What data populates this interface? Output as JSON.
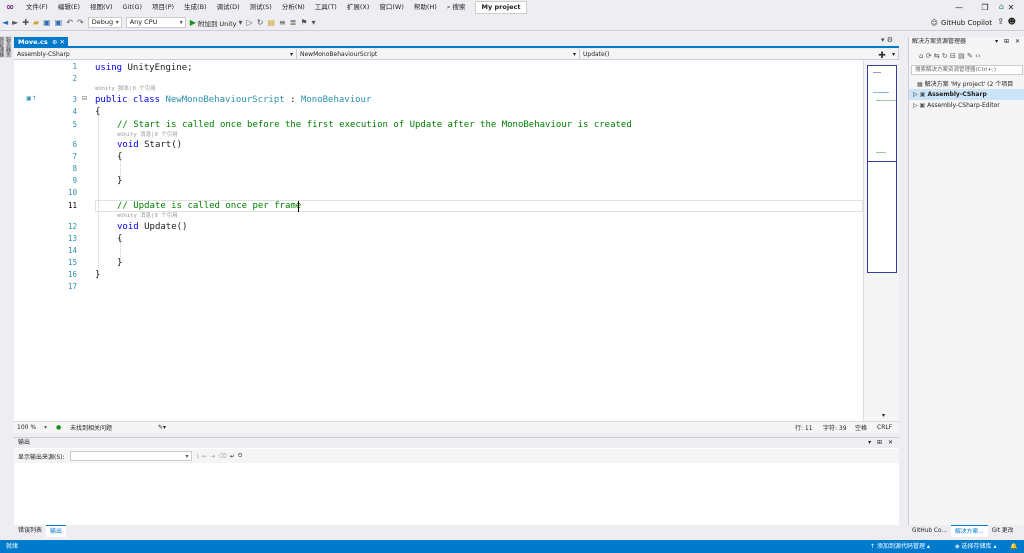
{
  "menu": {
    "items": [
      "文件(F)",
      "编辑(E)",
      "视图(V)",
      "Git(G)",
      "项目(P)",
      "生成(B)",
      "调试(D)",
      "测试(S)",
      "分析(N)",
      "工具(T)",
      "扩展(X)",
      "窗口(W)",
      "帮助(H)"
    ],
    "search": "搜索",
    "project": "My project"
  },
  "toolbar": {
    "config": "Debug",
    "platform": "Any CPU",
    "run": "附加到 Unity"
  },
  "copilot": "GitHub Copilot",
  "left_tab": "服务器资源管理器",
  "doc": {
    "tab": "Move.cs"
  },
  "nav": {
    "project": "Assembly-CSharp",
    "class": "NewMonoBehaviourScript",
    "member": "Update()"
  },
  "lines": [
    "1",
    "2",
    "3",
    "4",
    "5",
    "6",
    "7",
    "8",
    "9",
    "10",
    "11",
    "12",
    "13",
    "14",
    "15",
    "16",
    "17"
  ],
  "code": {
    "l1_kw": "using",
    "l1_rest": " UnityEngine;",
    "lens_class": "Unity 脚本|0 个引用",
    "l3_kw": "public class",
    "l3_type": "NewMonoBehaviourScript",
    "l3_colon": " : ",
    "l3_base": "MonoBehaviour",
    "l4": "{",
    "l5": "// Start is called once before the first execution of Update after the MonoBehaviour is created",
    "lens_start": "Unity 消息|0 个引用",
    "l6_kw": "void",
    "l6_rest": " Start()",
    "l7": "{",
    "l9": "}",
    "l11": "// Update is called once per frame",
    "lens_update": "Unity 消息|0 个引用",
    "l12_kw": "void",
    "l12_rest": " Update()",
    "l13": "{",
    "l15": "}",
    "l16": "}"
  },
  "editor_status": {
    "zoom": "100 %",
    "issues": "未找到相关问题",
    "line": "行: 11",
    "col": "字符: 39",
    "spacing": "空格",
    "eol": "CRLF"
  },
  "output": {
    "title": "输出",
    "source_label": "显示输出来源(S):"
  },
  "bottom_tabs": [
    "错误列表",
    "输出"
  ],
  "solution": {
    "title": "解决方案资源管理器",
    "search": "搜索解决方案资源管理器(Ctrl+;)",
    "root": "解决方案 'My project' (2 个项目",
    "proj1": "Assembly-CSharp",
    "proj2": "Assembly-CSharp-Editor",
    "tabs": [
      "GitHub Co...",
      "解决方案...",
      "Git 更改"
    ]
  },
  "status": {
    "ready": "就绪",
    "add_src": "添加到源代码管理",
    "repo": "选择存储库"
  },
  "colors": {
    "accent": "#007acc",
    "keyword": "#0000ff",
    "type": "#2b91af",
    "comment": "#008000"
  }
}
